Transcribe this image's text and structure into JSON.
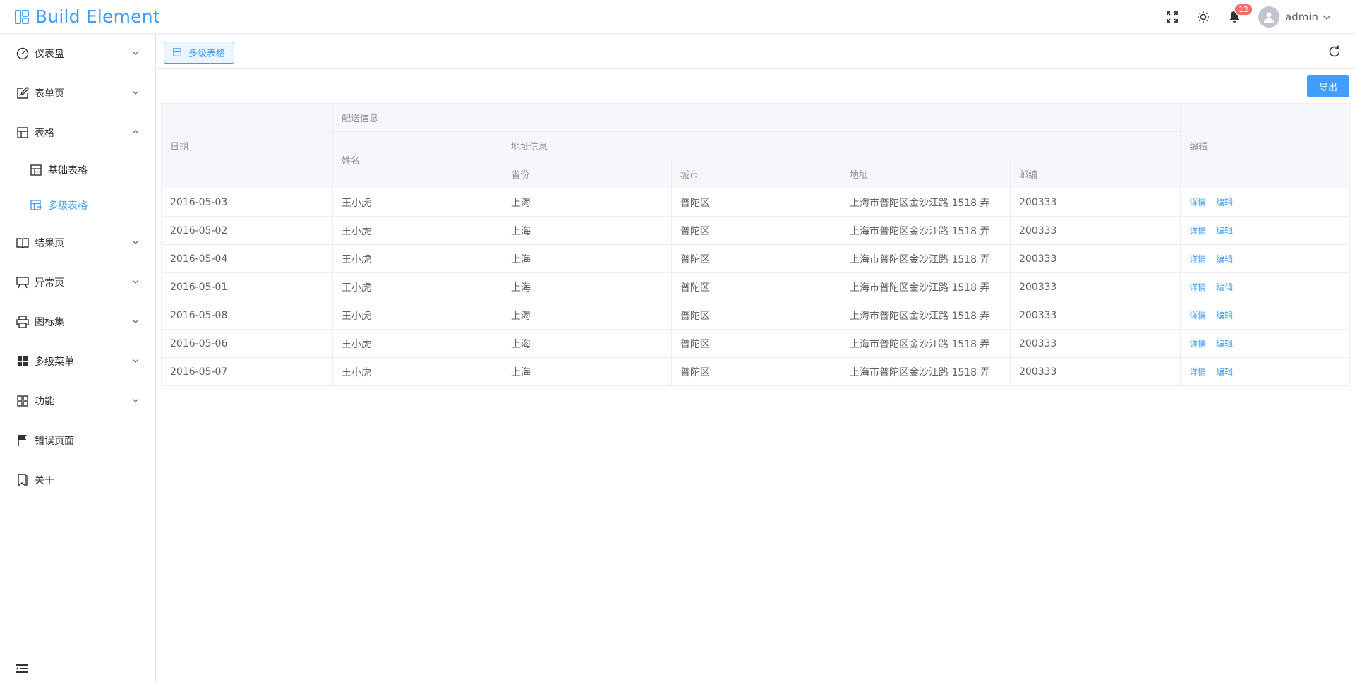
{
  "app": {
    "title": "Build Element"
  },
  "header": {
    "notifications_count": "12",
    "user_name": "admin"
  },
  "sidebar": {
    "items": [
      {
        "label": "仪表盘",
        "icon": "dashboard-icon",
        "expandable": true
      },
      {
        "label": "表单页",
        "icon": "edit-icon",
        "expandable": true
      },
      {
        "label": "表格",
        "icon": "table-icon",
        "expandable": true,
        "expanded": true,
        "children": [
          {
            "label": "基础表格",
            "icon": "basic-table-icon",
            "active": false
          },
          {
            "label": "多级表格",
            "icon": "multi-table-icon",
            "active": true
          }
        ]
      },
      {
        "label": "结果页",
        "icon": "book-icon",
        "expandable": true
      },
      {
        "label": "异常页",
        "icon": "board-icon",
        "expandable": true
      },
      {
        "label": "图标集",
        "icon": "printer-icon",
        "expandable": true
      },
      {
        "label": "多级菜单",
        "icon": "grid-icon",
        "expandable": true
      },
      {
        "label": "功能",
        "icon": "apps-icon",
        "expandable": true
      },
      {
        "label": "错误页面",
        "icon": "flag-icon",
        "expandable": false
      },
      {
        "label": "关于",
        "icon": "bookmark-icon",
        "expandable": false
      }
    ]
  },
  "tabs": {
    "active_label": "多级表格"
  },
  "toolbar": {
    "export_label": "导出"
  },
  "table": {
    "headers": {
      "date": "日期",
      "delivery": "配送信息",
      "name": "姓名",
      "address_info": "地址信息",
      "province": "省份",
      "city": "城市",
      "address": "地址",
      "zip": "邮编",
      "edit": "编辑"
    },
    "actions": {
      "detail": "详情",
      "edit": "编辑"
    },
    "rows": [
      {
        "date": "2016-05-03",
        "name": "王小虎",
        "province": "上海",
        "city": "普陀区",
        "address": "上海市普陀区金沙江路 1518 弄",
        "zip": "200333"
      },
      {
        "date": "2016-05-02",
        "name": "王小虎",
        "province": "上海",
        "city": "普陀区",
        "address": "上海市普陀区金沙江路 1518 弄",
        "zip": "200333"
      },
      {
        "date": "2016-05-04",
        "name": "王小虎",
        "province": "上海",
        "city": "普陀区",
        "address": "上海市普陀区金沙江路 1518 弄",
        "zip": "200333"
      },
      {
        "date": "2016-05-01",
        "name": "王小虎",
        "province": "上海",
        "city": "普陀区",
        "address": "上海市普陀区金沙江路 1518 弄",
        "zip": "200333"
      },
      {
        "date": "2016-05-08",
        "name": "王小虎",
        "province": "上海",
        "city": "普陀区",
        "address": "上海市普陀区金沙江路 1518 弄",
        "zip": "200333"
      },
      {
        "date": "2016-05-06",
        "name": "王小虎",
        "province": "上海",
        "city": "普陀区",
        "address": "上海市普陀区金沙江路 1518 弄",
        "zip": "200333"
      },
      {
        "date": "2016-05-07",
        "name": "王小虎",
        "province": "上海",
        "city": "普陀区",
        "address": "上海市普陀区金沙江路 1518 弄",
        "zip": "200333"
      }
    ]
  },
  "colors": {
    "primary": "#409eff",
    "badge": "#f56c6c",
    "header_bg": "#f5f7fa",
    "border": "#ebeef5"
  }
}
